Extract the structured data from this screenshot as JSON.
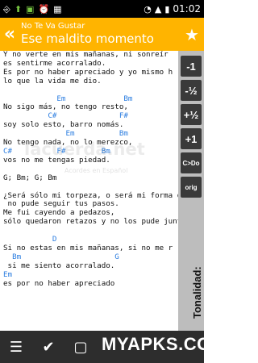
{
  "statusbar": {
    "time": "01:02"
  },
  "actionbar": {
    "subtitle": "No Te Va Gustar",
    "title": "Ese maldito momento"
  },
  "lyrics": [
    {
      "t": "Y no verte en mis mañanas, ni sonreír",
      "c": false
    },
    {
      "t": "es sentirme acorralado.",
      "c": false
    },
    {
      "t": "Es por no haber apreciado y yo mismo h",
      "c": false
    },
    {
      "t": "lo que la vida me dio.",
      "c": false
    },
    {
      "t": "",
      "c": false
    },
    {
      "t": "            Em             Bm",
      "c": true
    },
    {
      "t": "No sigo más, no tengo resto,",
      "c": false
    },
    {
      "t": "          C#              F#",
      "c": true
    },
    {
      "t": "soy solo esto, barro nomás.",
      "c": false
    },
    {
      "t": "              Em          Bm",
      "c": true
    },
    {
      "t": "No tengo nada, no lo merezco,",
      "c": false
    },
    {
      "t": "C#          F#        Bm",
      "c": true
    },
    {
      "t": "vos no me tengas piedad.",
      "c": false
    },
    {
      "t": "",
      "c": false
    },
    {
      "t": "G; Bm; G; Bm",
      "c": false
    },
    {
      "t": "",
      "c": false
    },
    {
      "t": "¿Será sólo mi torpeza, o será mi forma de",
      "c": false
    },
    {
      "t": " no pude seguir tus pasos.",
      "c": false
    },
    {
      "t": "Me fui cayendo a pedazos,",
      "c": false
    },
    {
      "t": "sólo quedaron retazos y no los pude juntar.",
      "c": false
    },
    {
      "t": "",
      "c": false
    },
    {
      "t": "           D",
      "c": true
    },
    {
      "t": "Si no estas en mis mañanas, si no me r",
      "c": false
    },
    {
      "t": "  Bm                     G",
      "c": true
    },
    {
      "t": " si me siento acorralado.",
      "c": false
    },
    {
      "t": "Em",
      "c": true
    },
    {
      "t": "es por no haber apreciado",
      "c": false
    }
  ],
  "watermark": {
    "main": "lacuerda.net",
    "sub": "Acordes en Español"
  },
  "sidebar": {
    "buttons": [
      "-1",
      "-½",
      "+½",
      "+1",
      "C>Do",
      "orig"
    ],
    "key_label": "Tonalidad:"
  },
  "overlay_text": "MYAPKS.COM"
}
